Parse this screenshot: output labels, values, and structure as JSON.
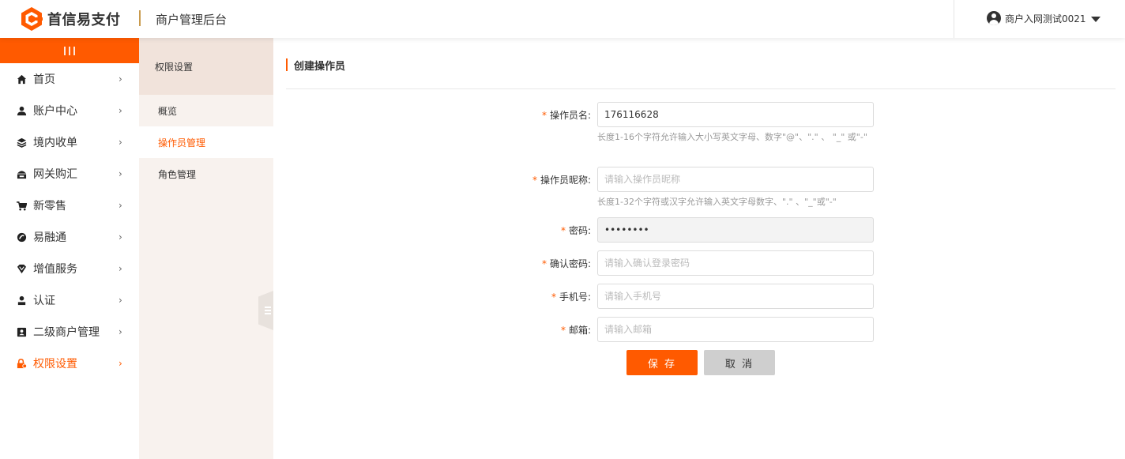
{
  "header": {
    "brand": "首信易支付",
    "title": "商户管理后台",
    "user": "商户入网测试0021"
  },
  "sidebar": {
    "items": [
      {
        "label": "首页",
        "icon": "home-icon"
      },
      {
        "label": "账户中心",
        "icon": "user-icon"
      },
      {
        "label": "境内收单",
        "icon": "layers-icon"
      },
      {
        "label": "网关购汇",
        "icon": "bank-icon"
      },
      {
        "label": "新零售",
        "icon": "cart-icon"
      },
      {
        "label": "易融通",
        "icon": "finance-icon"
      },
      {
        "label": "增值服务",
        "icon": "diamond-icon"
      },
      {
        "label": "认证",
        "icon": "person-badge-icon"
      },
      {
        "label": "二级商户管理",
        "icon": "id-card-icon"
      },
      {
        "label": "权限设置",
        "icon": "lock-icon"
      }
    ],
    "active_index": 9
  },
  "submenu": {
    "header": "权限设置",
    "items": [
      "概览",
      "操作员管理",
      "角色管理"
    ],
    "active_index": 1
  },
  "main": {
    "title": "创建操作员",
    "form": {
      "operator_name": {
        "label": "操作员名:",
        "value": "176116628",
        "hint": "长度1-16个字符允许输入大小写英文字母、数字\"@\"、\".\" 、 \"_\" 或\"-\""
      },
      "nickname": {
        "label": "操作员昵称:",
        "placeholder": "请输入操作员昵称",
        "hint": "长度1-32个字符或汉字允许输入英文字母数字、\".\" 、\"_\"或\"-\""
      },
      "password": {
        "label": "密码:",
        "value": "••••••••"
      },
      "confirm_password": {
        "label": "确认密码:",
        "placeholder": "请输入确认登录密码"
      },
      "phone": {
        "label": "手机号:",
        "placeholder": "请输入手机号"
      },
      "email": {
        "label": "邮箱:",
        "placeholder": "请输入邮箱"
      }
    },
    "buttons": {
      "save": "保 存",
      "cancel": "取 消"
    }
  },
  "colors": {
    "accent": "#ff5a00",
    "submenu_bg": "#f8f2ee",
    "submenu_head_bg": "#f1e3db"
  }
}
